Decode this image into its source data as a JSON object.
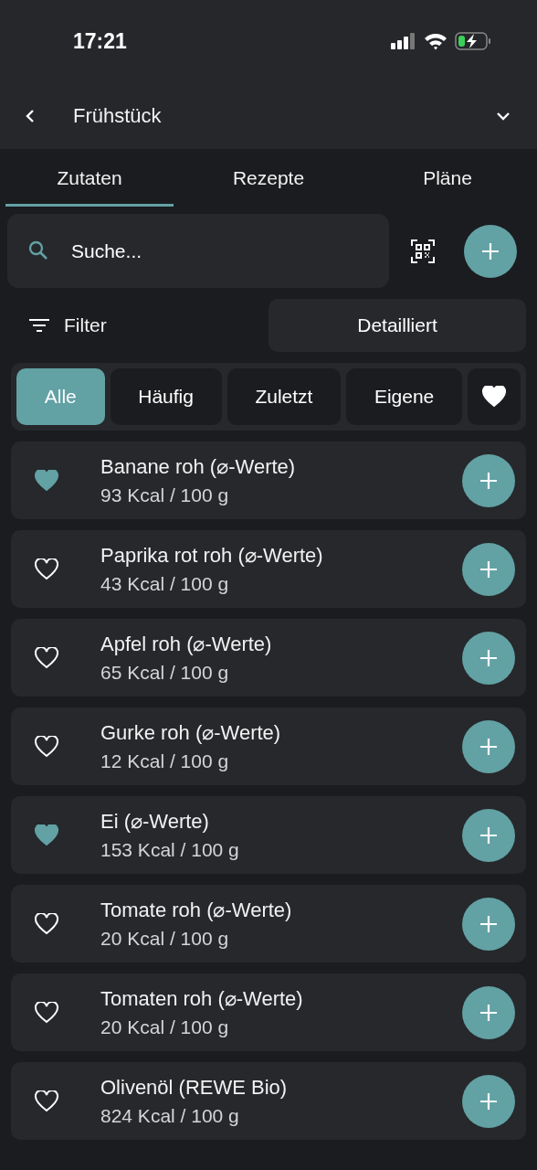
{
  "status_bar": {
    "time": "17:21"
  },
  "header": {
    "title": "Frühstück"
  },
  "tabs": [
    {
      "label": "Zutaten",
      "selected": true
    },
    {
      "label": "Rezepte",
      "selected": false
    },
    {
      "label": "Pläne",
      "selected": false
    }
  ],
  "search": {
    "placeholder": "Suche..."
  },
  "filter": {
    "label": "Filter"
  },
  "view_button": {
    "label": "Detailliert"
  },
  "chips": [
    {
      "kind": "text",
      "label": "Alle",
      "selected": true
    },
    {
      "kind": "text",
      "label": "Häufig",
      "selected": false
    },
    {
      "kind": "text",
      "label": "Zuletzt",
      "selected": false
    },
    {
      "kind": "text",
      "label": "Eigene",
      "selected": false
    },
    {
      "kind": "favorite",
      "selected": false
    }
  ],
  "foods": [
    {
      "name": "Banane roh (⌀-Werte)",
      "calories": "93 Kcal / 100 g",
      "favorite": true
    },
    {
      "name": "Paprika rot roh (⌀-Werte)",
      "calories": "43 Kcal / 100 g",
      "favorite": false
    },
    {
      "name": "Apfel roh (⌀-Werte)",
      "calories": "65 Kcal / 100 g",
      "favorite": false
    },
    {
      "name": "Gurke roh (⌀-Werte)",
      "calories": "12 Kcal / 100 g",
      "favorite": false
    },
    {
      "name": "Ei (⌀-Werte)",
      "calories": "153 Kcal / 100 g",
      "favorite": true
    },
    {
      "name": "Tomate roh (⌀-Werte)",
      "calories": "20 Kcal / 100 g",
      "favorite": false
    },
    {
      "name": "Tomaten roh (⌀-Werte)",
      "calories": "20 Kcal / 100 g",
      "favorite": false
    },
    {
      "name": "Olivenöl (REWE Bio)",
      "calories": "824 Kcal / 100 g",
      "favorite": false
    }
  ]
}
